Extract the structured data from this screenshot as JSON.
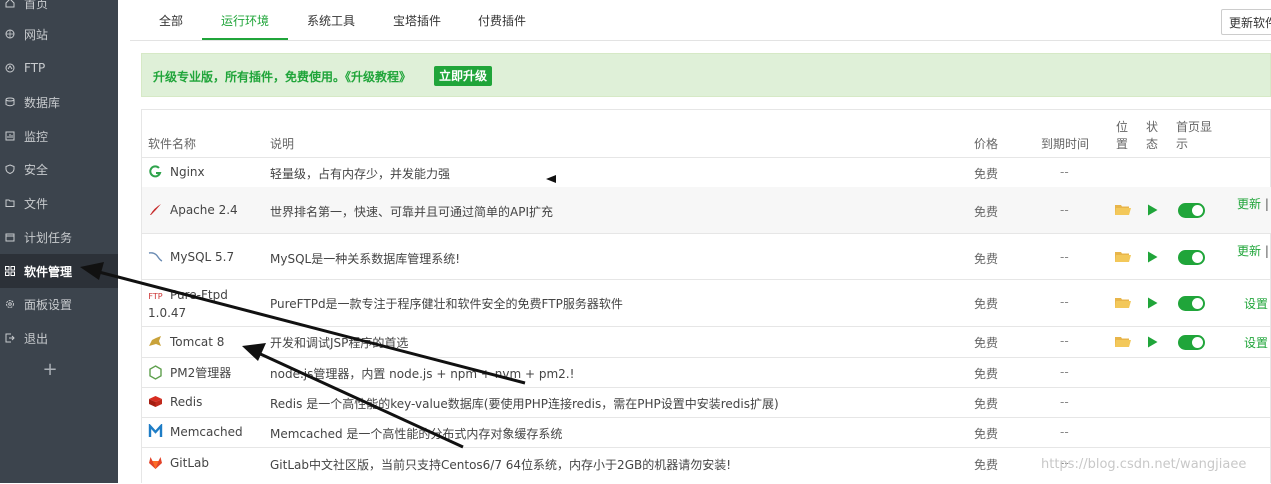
{
  "sidebar": {
    "items": [
      {
        "label": "首页",
        "icon": "home-icon"
      },
      {
        "label": "网站",
        "icon": "globe-icon"
      },
      {
        "label": "FTP",
        "icon": "ftp-icon"
      },
      {
        "label": "数据库",
        "icon": "database-icon"
      },
      {
        "label": "监控",
        "icon": "monitor-icon"
      },
      {
        "label": "安全",
        "icon": "shield-icon"
      },
      {
        "label": "文件",
        "icon": "folder-icon"
      },
      {
        "label": "计划任务",
        "icon": "calendar-icon"
      },
      {
        "label": "软件管理",
        "icon": "grid-icon",
        "active": true
      },
      {
        "label": "面板设置",
        "icon": "gear-icon"
      },
      {
        "label": "退出",
        "icon": "logout-icon"
      }
    ],
    "add": "+"
  },
  "tabs": [
    {
      "label": "全部"
    },
    {
      "label": "运行环境",
      "active": true
    },
    {
      "label": "系统工具"
    },
    {
      "label": "宝塔插件"
    },
    {
      "label": "付费插件"
    }
  ],
  "update_button": "更新软件",
  "banner": {
    "text": "升级专业版，所有插件，免费使用。《升级教程》",
    "button": "立即升级"
  },
  "table": {
    "headers": {
      "name": "软件名称",
      "desc": "说明",
      "price": "价格",
      "expire": "到期时间",
      "position_1": "位",
      "position_2": "置",
      "status_1": "状",
      "status_2": "态",
      "home_1": "首页显",
      "home_2": "示"
    },
    "rows": [
      {
        "name": "Nginx",
        "desc": "轻量级，占有内存少，并发能力强",
        "price": "免费",
        "expire": "--",
        "icon": "nginx-icon"
      },
      {
        "name": "Apache 2.4",
        "desc": "世界排名第一，快速、可靠并且可通过简单的API扩充",
        "price": "免费",
        "expire": "--",
        "icon": "apache-icon",
        "op": "更新",
        "op_sep": "|"
      },
      {
        "name": "MySQL 5.7",
        "desc": "MySQL是一种关系数据库管理系统!",
        "price": "免费",
        "expire": "--",
        "icon": "mysql-icon",
        "op": "更新",
        "op_sep": "|"
      },
      {
        "name": "Pure-Ftpd",
        "version": "1.0.47",
        "desc": "PureFTPd是一款专注于程序健壮和软件安全的免费FTP服务器软件",
        "price": "免费",
        "expire": "--",
        "icon": "ftp-logo-icon",
        "op": "设置"
      },
      {
        "name": "Tomcat 8",
        "desc": "开发和调试JSP程序的首选",
        "price": "免费",
        "expire": "--",
        "icon": "tomcat-icon",
        "op": "设置"
      },
      {
        "name": "PM2管理器",
        "desc": "node.js管理器，内置 node.js + npm + nvm + pm2.!",
        "price": "免费",
        "expire": "--",
        "icon": "nodejs-icon"
      },
      {
        "name": "Redis",
        "desc": "Redis 是一个高性能的key-value数据库(要使用PHP连接redis，需在PHP设置中安装redis扩展)",
        "price": "免费",
        "expire": "--",
        "icon": "redis-icon"
      },
      {
        "name": "Memcached",
        "desc": "Memcached 是一个高性能的分布式内存对象缓存系统",
        "price": "免费",
        "expire": "--",
        "icon": "memcached-icon"
      },
      {
        "name": "GitLab",
        "desc": "GitLab中文社区版，当前只支持Centos6/7 64位系统，内存小于2GB的机器请勿安装!",
        "price": "免费",
        "expire": "--",
        "icon": "gitlab-icon"
      }
    ]
  },
  "watermark": "https://blog.csdn.net/wangjiaee",
  "colors": {
    "accent": "#20a53a",
    "sidebar": "#3c444d",
    "sidebar_active": "#2c3138",
    "banner_bg": "#dff0d8"
  }
}
